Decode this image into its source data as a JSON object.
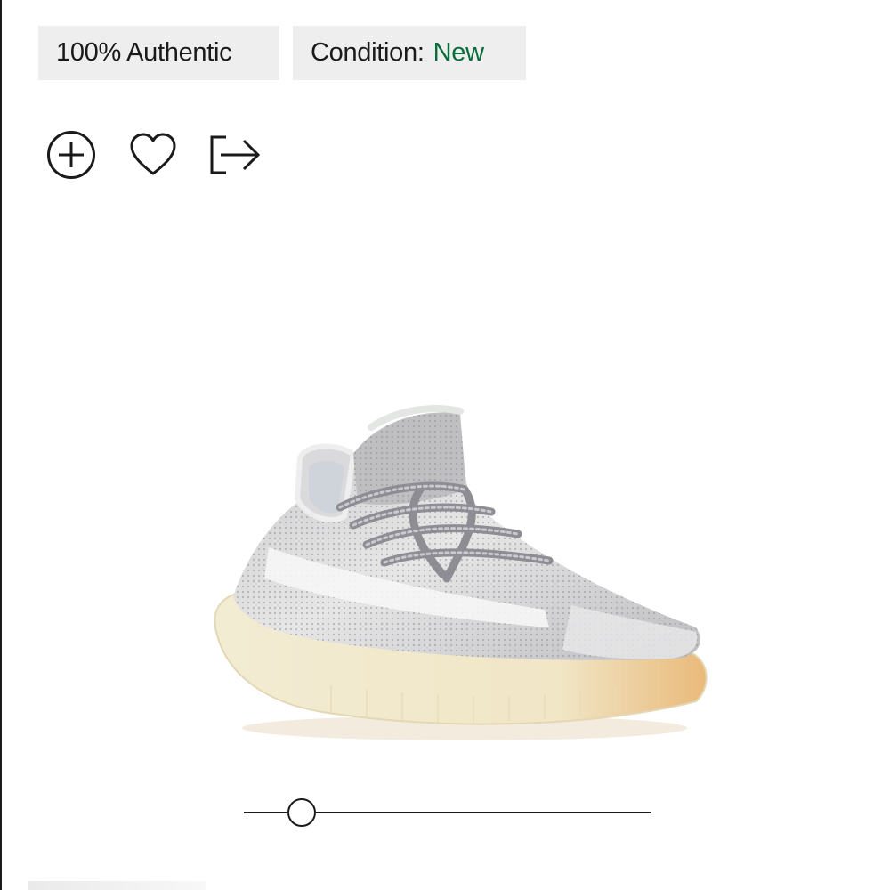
{
  "badges": {
    "authentic_label": "100% Authentic",
    "condition_label": "Condition:",
    "condition_value": "New",
    "condition_color": "#0a6b3b"
  },
  "actions": [
    {
      "icon": "plus-circle-icon",
      "name": "add-to-portfolio"
    },
    {
      "icon": "heart-icon",
      "name": "favorite"
    },
    {
      "icon": "share-icon",
      "name": "share"
    }
  ],
  "product_image": {
    "description": "Grey and white knit sneaker with reflective laces and translucent gum sole"
  },
  "image_viewer_slider": {
    "value_fraction": 0.14
  }
}
